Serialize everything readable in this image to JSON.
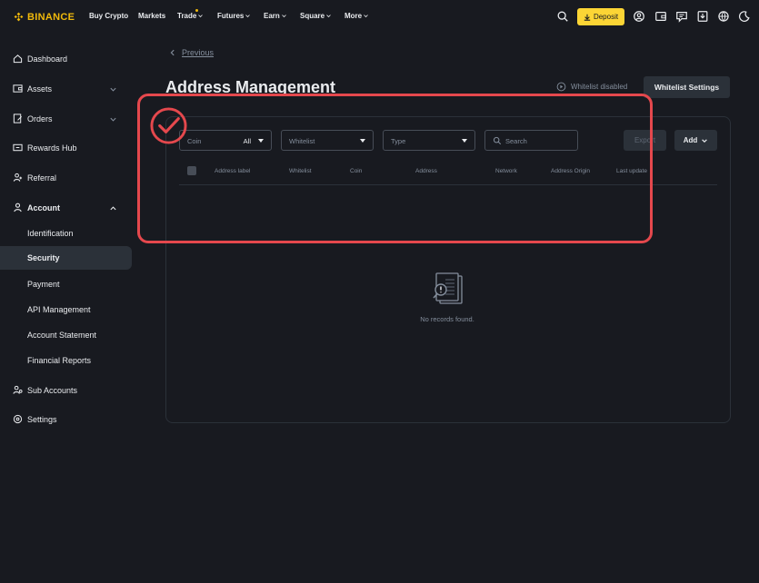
{
  "brand": {
    "name": "BINANCE",
    "color": "#f0b90b"
  },
  "nav": {
    "buy_crypto": "Buy Crypto",
    "markets": "Markets",
    "trade": "Trade",
    "futures": "Futures",
    "earn": "Earn",
    "square": "Square",
    "more": "More",
    "deposit": "Deposit",
    "icons": [
      "search-icon",
      "user-icon",
      "wallet-icon",
      "message-icon",
      "download-icon",
      "globe-icon",
      "theme-toggle-icon"
    ]
  },
  "sidebar": {
    "dashboard": "Dashboard",
    "assets": "Assets",
    "orders": "Orders",
    "rewards_hub": "Rewards Hub",
    "referral": "Referral",
    "account": "Account",
    "identification": "Identification",
    "security": "Security",
    "payment": "Payment",
    "api_management": "API Management",
    "account_statement": "Account Statement",
    "financial_reports": "Financial Reports",
    "sub_accounts": "Sub Accounts",
    "settings": "Settings"
  },
  "main": {
    "previous": "Previous",
    "title": "Address Management",
    "whitelist_status": "Whitelist disabled",
    "whitelist_settings": "Whitelist Settings"
  },
  "filters": {
    "coin_label": "Coin",
    "coin_value": "All",
    "whitelist_placeholder": "Whitelist",
    "type_placeholder": "Type",
    "search_placeholder": "Search",
    "export": "Export",
    "add": "Add"
  },
  "table": {
    "columns": [
      "Address label",
      "Whitelist",
      "Coin",
      "Address",
      "Network",
      "Address Origin",
      "Last update"
    ],
    "empty_message": "No records found."
  },
  "colors": {
    "accent": "#fcd535",
    "background": "#181a20",
    "annotation": "#e5484d"
  }
}
